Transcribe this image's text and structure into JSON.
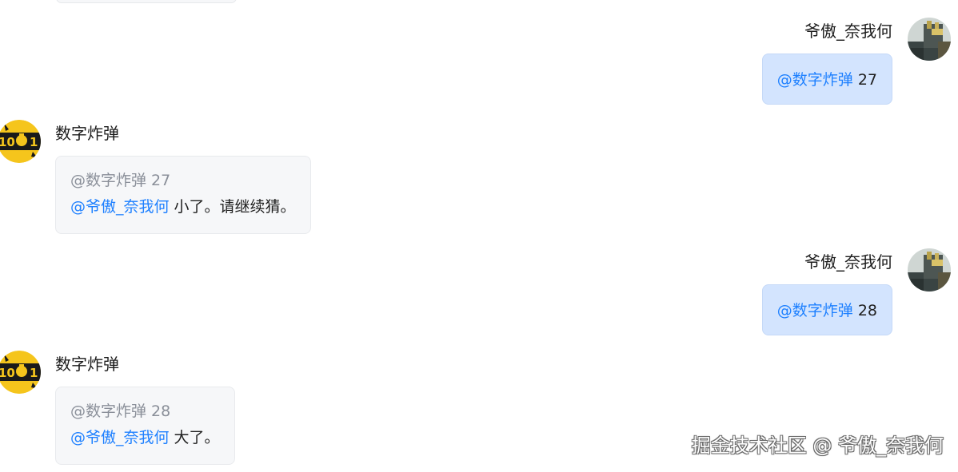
{
  "messages": [
    {
      "direction": "outgoing",
      "sender": "爷傲_奈我何",
      "avatar_icon": "user-photo-avatar",
      "mention": "@数字炸弹",
      "text": " 27"
    },
    {
      "direction": "incoming",
      "sender": "数字炸弹",
      "avatar_icon": "bomb-bot-avatar",
      "quote_mention": "@数字炸弹",
      "quote_text": " 27",
      "mention": "@爷傲_奈我何",
      "text": " 小了。请继续猜。"
    },
    {
      "direction": "outgoing",
      "sender": "爷傲_奈我何",
      "avatar_icon": "user-photo-avatar",
      "mention": "@数字炸弹",
      "text": " 28"
    },
    {
      "direction": "incoming",
      "sender": "数字炸弹",
      "avatar_icon": "bomb-bot-avatar",
      "quote_mention": "@数字炸弹",
      "quote_text": " 28",
      "mention": "@爷傲_奈我何",
      "text": " 大了。"
    }
  ],
  "watermark": "掘金技术社区 @ 爷傲_奈我何",
  "colors": {
    "mention": "#1e80ff",
    "outgoing_bubble": "#d3e4fe",
    "incoming_bubble": "#f6f7f9",
    "quote_text": "#8a8f99",
    "bot_avatar_yellow": "#f5c51c"
  }
}
